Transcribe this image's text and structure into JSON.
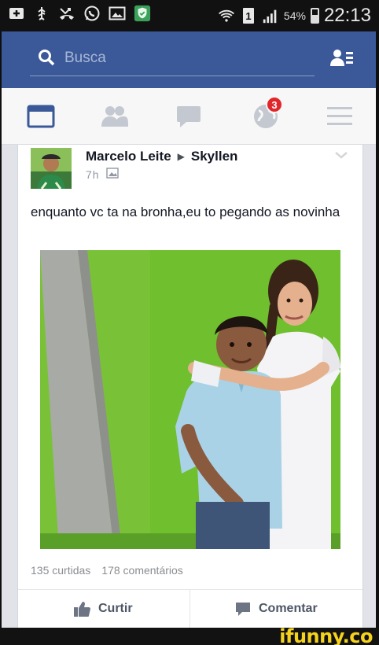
{
  "status_bar": {
    "icons": [
      "plus-box-icon",
      "usb-icon",
      "missed-call-icon",
      "whatsapp-icon",
      "gallery-icon",
      "shield-icon",
      "wifi-icon",
      "sim-icon",
      "signal-icon"
    ],
    "battery_percent": "54%",
    "time": "22:13"
  },
  "search": {
    "placeholder": "Busca",
    "icons": [
      "search-icon",
      "friend-requests-icon"
    ]
  },
  "tabs": [
    {
      "name": "news-feed",
      "icon": "news-feed-icon",
      "active": true
    },
    {
      "name": "friends",
      "icon": "friends-icon"
    },
    {
      "name": "messages",
      "icon": "chat-icon"
    },
    {
      "name": "notifications",
      "icon": "globe-icon",
      "badge": "3"
    },
    {
      "name": "menu",
      "icon": "hamburger-icon"
    }
  ],
  "post": {
    "author": "Marcelo Leite",
    "target": "Skyllen",
    "time": "7h",
    "text": "enquanto vc ta na bronha,eu to pegando as novinha",
    "likes": "135 curtidas",
    "comments": "178 comentários",
    "actions": {
      "like": "Curtir",
      "comment": "Comentar"
    }
  },
  "watermark": "ifunny.co",
  "colors": {
    "brand_blue": "#3b5998",
    "badge_red": "#e0262a",
    "watermark_yellow": "#f5d21c"
  }
}
